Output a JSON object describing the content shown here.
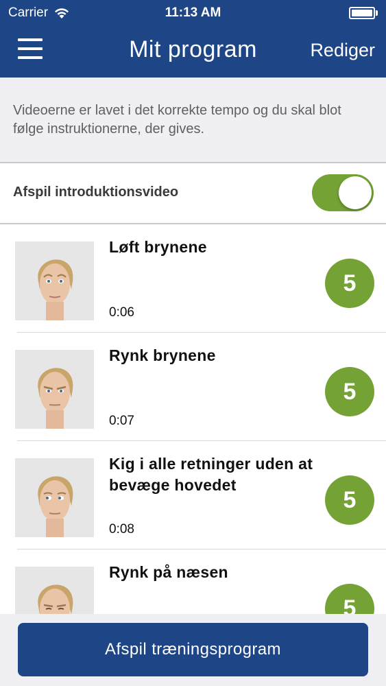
{
  "status_bar": {
    "carrier": "Carrier",
    "time": "11:13 AM"
  },
  "nav": {
    "title": "Mit program",
    "edit_label": "Rediger",
    "menu_icon": "hamburger-menu-icon"
  },
  "info": {
    "text": "Videoerne er lavet i det korrekte tempo og du skal blot følge instruktionerne, der gives."
  },
  "intro_toggle": {
    "label": "Afspil introduktionsvideo",
    "enabled": true
  },
  "exercises": [
    {
      "title": "Løft brynene",
      "duration": "0:06",
      "repetitions": "5"
    },
    {
      "title": "Rynk brynene",
      "duration": "0:07",
      "repetitions": "5"
    },
    {
      "title": "Kig i alle retninger uden at bevæge hovedet",
      "duration": "0:08",
      "repetitions": "5"
    },
    {
      "title": "Rynk på næsen",
      "duration": "",
      "repetitions": "5"
    }
  ],
  "footer": {
    "play_label": "Afspil træningsprogram"
  },
  "colors": {
    "brand_blue": "#1e4585",
    "accent_green": "#74a235",
    "background_gray": "#efeff4"
  }
}
